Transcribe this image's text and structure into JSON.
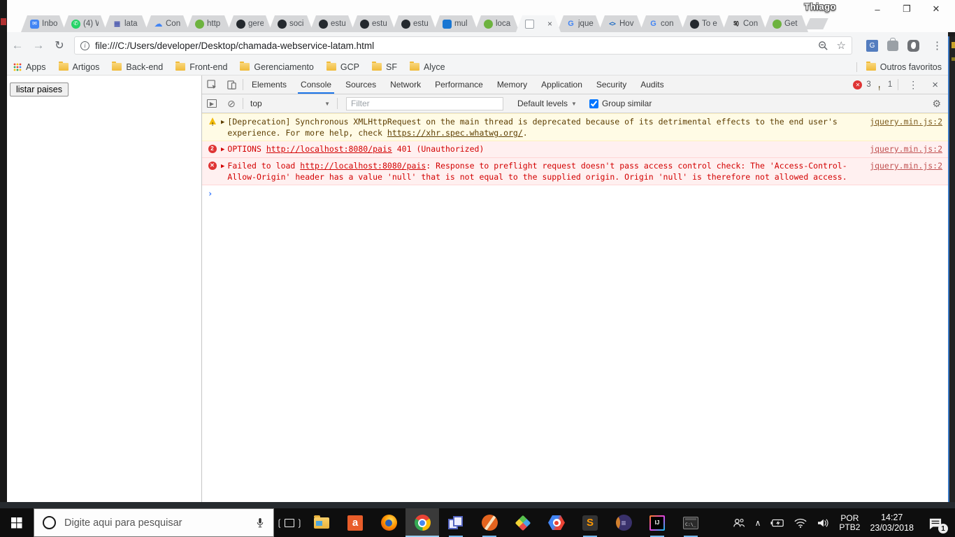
{
  "colors": {
    "warning_bg": "#fffbe5",
    "warning_text": "#5c3d00",
    "error_bg": "#fff0f0",
    "error_text": "#d30000",
    "devtools_accent": "#1a73e8",
    "taskbar_run_indicator": "#76b9ed"
  },
  "browser": {
    "profile_name": "Thiago",
    "window_controls": {
      "minimize": "–",
      "maximize": "❐",
      "close": "✕"
    },
    "tabs": [
      {
        "label": "Inbo",
        "icon": "inbox-mail"
      },
      {
        "label": "(4) W",
        "icon": "whatsapp"
      },
      {
        "label": "lata",
        "icon": "layers"
      },
      {
        "label": "Con",
        "icon": "gcloud"
      },
      {
        "label": "http",
        "icon": "spring"
      },
      {
        "label": "gere",
        "icon": "github"
      },
      {
        "label": "soci",
        "icon": "github"
      },
      {
        "label": "estu",
        "icon": "github"
      },
      {
        "label": "estu",
        "icon": "github"
      },
      {
        "label": "estu",
        "icon": "github"
      },
      {
        "label": "mul",
        "icon": "bluebox"
      },
      {
        "label": "loca",
        "icon": "spring"
      },
      {
        "label": "",
        "icon": "page",
        "active": true,
        "close": "×"
      },
      {
        "label": "jque",
        "icon": "google"
      },
      {
        "label": "Hov",
        "icon": "code"
      },
      {
        "label": "con",
        "icon": "google"
      },
      {
        "label": "To e",
        "icon": "github"
      },
      {
        "label": "Con",
        "icon": "jquery"
      },
      {
        "label": "Get",
        "icon": "spring"
      }
    ],
    "toolbar": {
      "url": "file:///C:/Users/developer/Desktop/chamada-webservice-latam.html"
    },
    "bookmarks": {
      "apps_label": "Apps",
      "folders": [
        "Artigos",
        "Back-end",
        "Front-end",
        "Gerenciamento",
        "GCP",
        "SF",
        "Alyce"
      ],
      "other_label": "Outros favoritos"
    }
  },
  "page": {
    "button_label": "listar paises"
  },
  "devtools": {
    "tabs": [
      "Elements",
      "Console",
      "Sources",
      "Network",
      "Performance",
      "Memory",
      "Application",
      "Security",
      "Audits"
    ],
    "active_tab": "Console",
    "error_count": "3",
    "warning_count": "1",
    "console_toolbar": {
      "context": "top",
      "filter_placeholder": "Filter",
      "levels_label": "Default levels",
      "group_similar_label": "Group similar",
      "group_similar_checked": true
    },
    "messages": [
      {
        "level": "warning",
        "icon": "warning-triangle",
        "prefix": "[Deprecation] Synchronous XMLHttpRequest on the main thread is deprecated because of its detrimental effects to the end user's experience. For more help, check ",
        "link": "https://xhr.spec.whatwg.org/",
        "suffix": ".",
        "source": "jquery.min.js:2"
      },
      {
        "level": "error",
        "icon": "badge-count",
        "badge": "2",
        "prefix": "OPTIONS ",
        "link": "http://localhost:8080/pais",
        "suffix": " 401 (Unauthorized)",
        "source": "jquery.min.js:2"
      },
      {
        "level": "error",
        "icon": "error-circle",
        "badge": "✕",
        "prefix": "Failed to load ",
        "link": "http://localhost:8080/pais",
        "suffix": ": Response to preflight request doesn't pass access control check: The 'Access-Control-Allow-Origin' header has a value 'null' that is not equal to the supplied origin. Origin 'null' is therefore not allowed access.",
        "source": "jquery.min.js:2"
      }
    ],
    "prompt": "›"
  },
  "taskbar": {
    "search_placeholder": "Digite aqui para pesquisar",
    "apps": [
      {
        "name": "file-explorer",
        "running": false
      },
      {
        "name": "orange-a-app",
        "running": false
      },
      {
        "name": "firefox",
        "running": false
      },
      {
        "name": "chrome",
        "running": true,
        "active": true
      },
      {
        "name": "blue-docs-app",
        "running": true
      },
      {
        "name": "soapui",
        "running": true
      },
      {
        "name": "diamond-tool",
        "running": false
      },
      {
        "name": "gcp-hexagon",
        "running": false
      },
      {
        "name": "sublime-text",
        "running": true
      },
      {
        "name": "eclipse",
        "running": false
      },
      {
        "name": "intellij",
        "running": true
      },
      {
        "name": "cmd",
        "running": true
      }
    ],
    "tray": {
      "language_top": "POR",
      "language_bottom": "PTB2",
      "time": "14:27",
      "date": "23/03/2018",
      "notification_badge": "1"
    }
  }
}
